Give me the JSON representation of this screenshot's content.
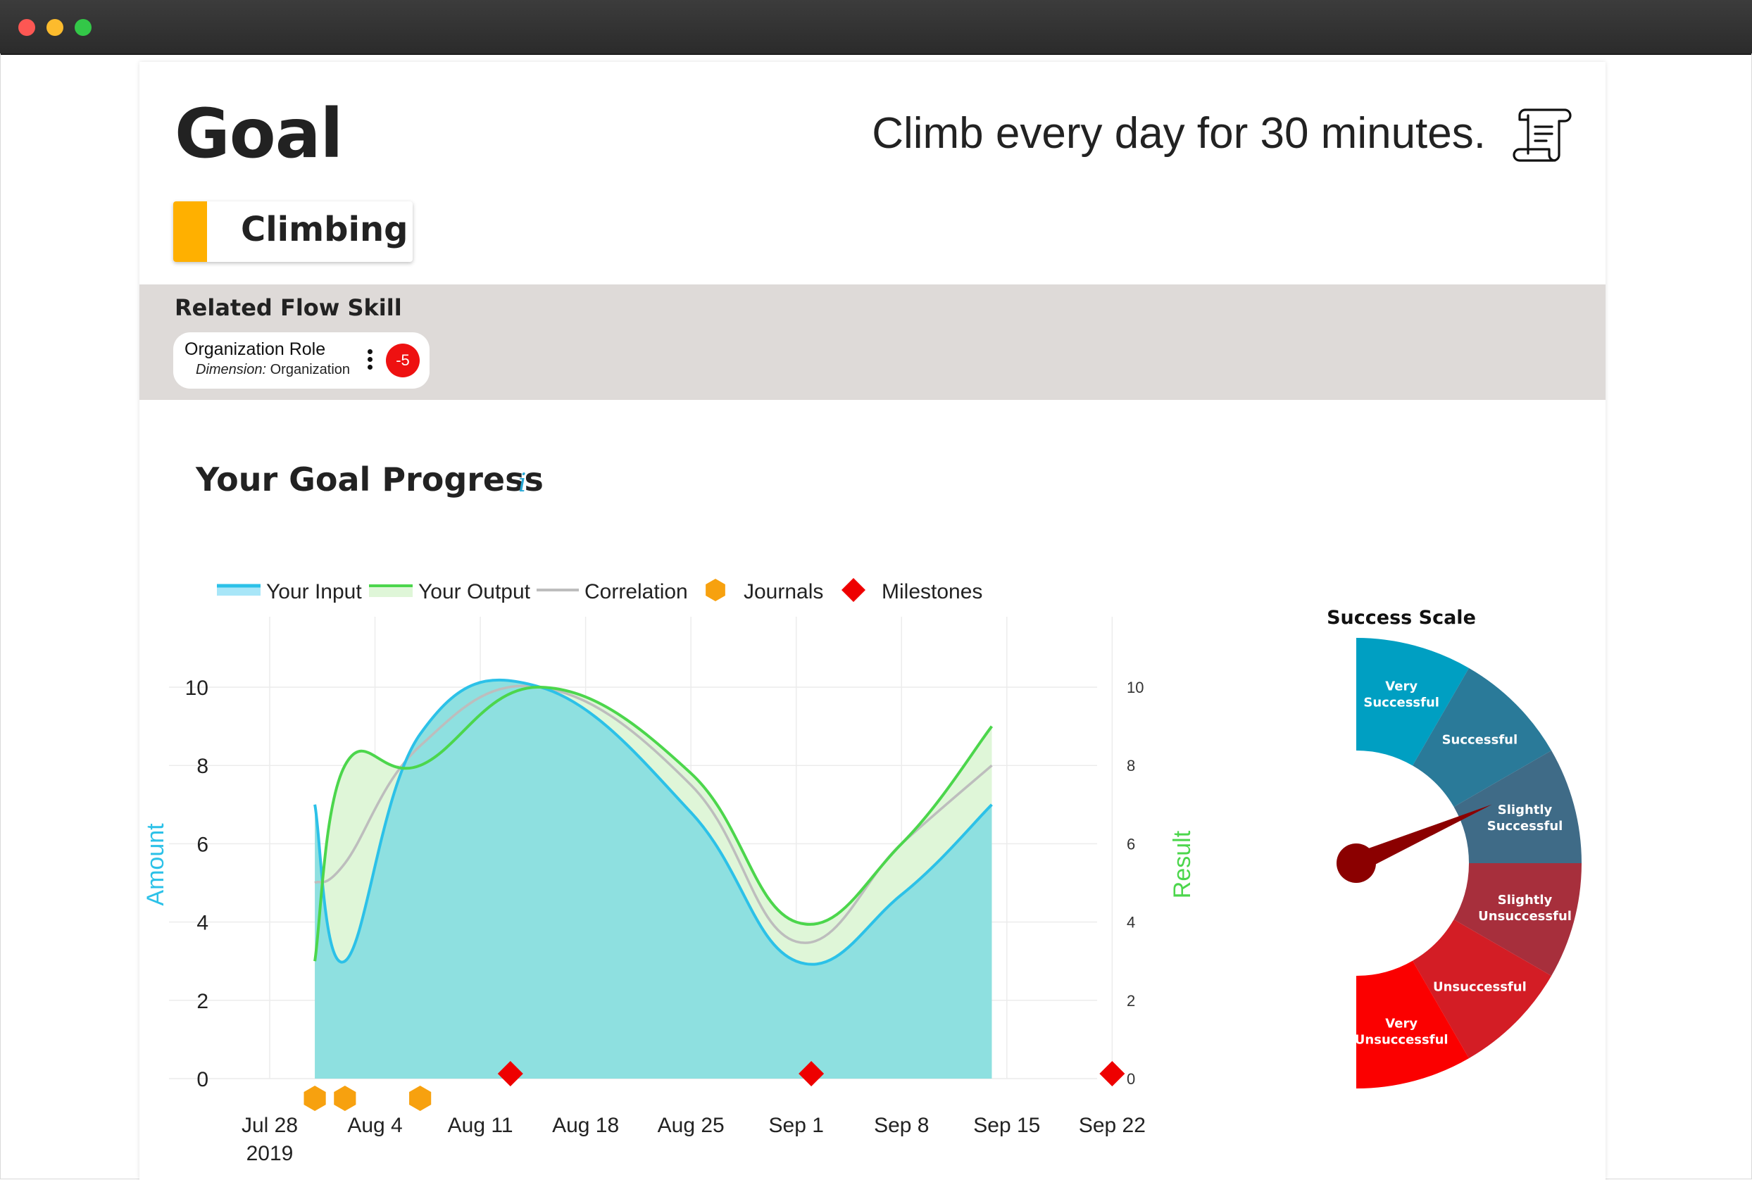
{
  "window": {
    "controls": [
      "close",
      "minimize",
      "maximize"
    ]
  },
  "header": {
    "title": "Goal",
    "description": "Climb every day for 30 minutes.",
    "icon": "scroll-icon"
  },
  "goal_chip": {
    "label": "Climbing",
    "color": "#ffb000"
  },
  "related": {
    "title": "Related Flow Skill",
    "skill_name": "Organization Role",
    "dimension_label": "Dimension:",
    "dimension_value": "Organization",
    "badge": "-5"
  },
  "progress": {
    "title": "Your Goal Progress",
    "info_icon": "i"
  },
  "legend": {
    "input": "Your Input",
    "output": "Your Output",
    "correlation": "Correlation",
    "journals": "Journals",
    "milestones": "Milestones"
  },
  "colors": {
    "input": "#2cc1e8",
    "output": "#4cd64c",
    "correlation": "#bdbdbd",
    "journal": "#f7a10f",
    "milestone": "#ee0000",
    "input_fill": "#8ee0e0",
    "output_fill": "#dff6d8"
  },
  "chart_data": {
    "type": "line",
    "xlabel": "",
    "y_left_label": "Amount",
    "y_right_label": "Result",
    "ylim": [
      0,
      10
    ],
    "y_ticks": [
      "0",
      "2",
      "4",
      "6",
      "8",
      "10"
    ],
    "x_ticks": [
      "Jul 28",
      "Aug 4",
      "Aug 11",
      "Aug 18",
      "Aug 25",
      "Sep 1",
      "Sep 8",
      "Sep 15",
      "Sep 22"
    ],
    "x_year_label": "2019",
    "grid": true,
    "series": [
      {
        "name": "Your Input",
        "points": [
          [
            "2019-07-31",
            7
          ],
          [
            "2019-08-02",
            3
          ],
          [
            "2019-08-07",
            8.8
          ],
          [
            "2019-08-15",
            10
          ],
          [
            "2019-08-25",
            6.8
          ],
          [
            "2019-09-01",
            3
          ],
          [
            "2019-09-08",
            4.7
          ],
          [
            "2019-09-14",
            7
          ]
        ]
      },
      {
        "name": "Your Output",
        "points": [
          [
            "2019-07-31",
            3
          ],
          [
            "2019-08-02",
            8
          ],
          [
            "2019-08-07",
            8
          ],
          [
            "2019-08-15",
            10
          ],
          [
            "2019-08-25",
            7.8
          ],
          [
            "2019-09-01",
            4
          ],
          [
            "2019-09-08",
            6
          ],
          [
            "2019-09-14",
            9
          ]
        ]
      },
      {
        "name": "Correlation",
        "points": [
          [
            "2019-07-31",
            5
          ],
          [
            "2019-08-02",
            5.5
          ],
          [
            "2019-08-07",
            8.5
          ],
          [
            "2019-08-15",
            10
          ],
          [
            "2019-08-25",
            7.5
          ],
          [
            "2019-09-01",
            3.5
          ],
          [
            "2019-09-08",
            6
          ],
          [
            "2019-09-14",
            8
          ]
        ]
      }
    ],
    "journals": [
      "2019-07-31",
      "2019-08-02",
      "2019-08-07"
    ],
    "milestones": [
      "2019-08-13",
      "2019-09-02",
      "2019-09-22"
    ]
  },
  "gauge": {
    "title": "Success Scale",
    "segments": [
      {
        "label": "Very Successful",
        "color": "#009fc2"
      },
      {
        "label": "Successful",
        "color": "#2a7a99"
      },
      {
        "label": "Slightly Successful",
        "color": "#3f6b87"
      },
      {
        "label": "Slightly Unsuccessful",
        "color": "#a72f3c"
      },
      {
        "label": "Unsuccessful",
        "color": "#d31d25"
      },
      {
        "label": "Very Unsuccessful",
        "color": "#fb0000"
      }
    ],
    "needle_color": "#8b0000",
    "value_fraction": 0.37
  }
}
